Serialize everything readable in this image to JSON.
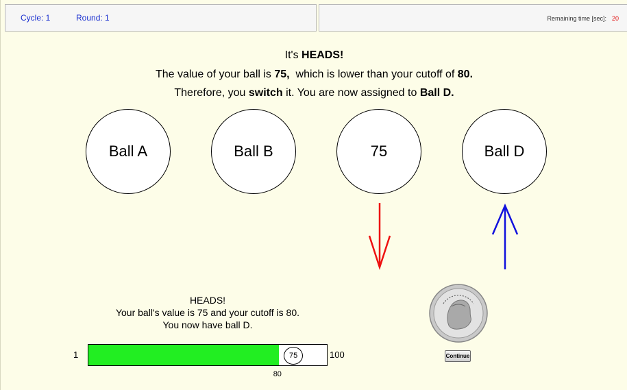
{
  "header": {
    "cycle": "Cycle: 1",
    "round": "Round: 1",
    "remaining_label": "Remaining time [sec]:",
    "remaining_value": "20"
  },
  "message": {
    "line1_pre": "It's ",
    "line1_bold": "HEADS!",
    "line2_pre": "The value of your ball is ",
    "line2_bold1": "75,",
    "line2_mid": "  which is lower than your cutoff of ",
    "line2_bold2": "80.",
    "line3_pre": "Therefore, you ",
    "line3_bold1": "switch",
    "line3_mid": " it. You are now assigned to ",
    "line3_bold2": "Ball D."
  },
  "balls": [
    "Ball A",
    "Ball B",
    "75",
    "Ball D"
  ],
  "summary": {
    "line1": "HEADS!",
    "line2": "Your ball's value is 75 and your cutoff is 80.",
    "line3": "You now have ball D."
  },
  "bar": {
    "min_label": "1",
    "max_label": "100",
    "min": 1,
    "max": 100,
    "cutoff": 80,
    "cutoff_label": "80",
    "ball_value": 75,
    "ball_label": "75"
  },
  "continue_label": "Continue",
  "colors": {
    "background": "#fdfde8",
    "header_text": "#1a2fd0",
    "timer": "#e01010",
    "fill": "#22ee22",
    "arrow_down": "#ee1111",
    "arrow_up": "#1111dd"
  },
  "icons": {
    "coin": "quarter-dollar-coin-icon"
  }
}
